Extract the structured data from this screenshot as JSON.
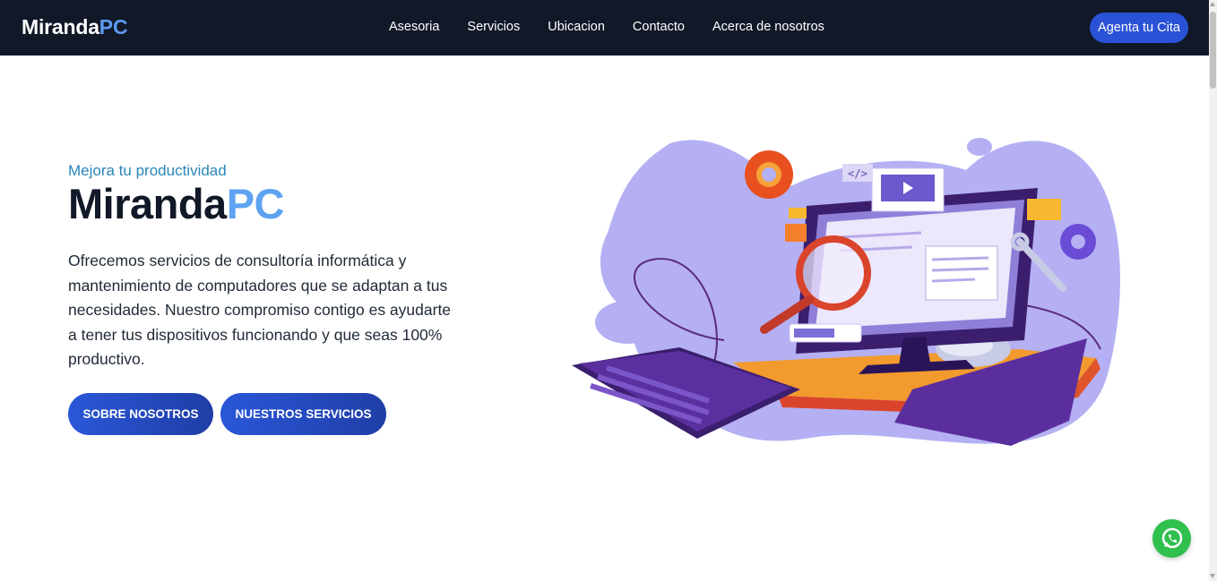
{
  "header": {
    "brand_main": "Miranda",
    "brand_accent": "PC",
    "nav": [
      "Asesoria",
      "Servicios",
      "Ubicacion",
      "Contacto",
      "Acerca de nosotros"
    ],
    "cta_label": "Agenta tu Cita"
  },
  "hero": {
    "eyebrow": "Mejora tu productividad",
    "title_main": "Miranda",
    "title_accent": "PC",
    "description": "Ofrecemos servicios de consultoría informática y mantenimiento de computadores que se adaptan a tus necesidades. Nuestro compromiso contigo es ayudarte a tener tus dispositivos funcionando y que seas 100% productivo.",
    "button_about": "SOBRE NOSOTROS",
    "button_services": "NUESTROS SERVICIOS"
  },
  "colors": {
    "navbar_bg": "#111827",
    "accent_blue": "#5b9cf0",
    "button_blue": "#2a52d6",
    "eyebrow": "#2a86b8",
    "whatsapp_green": "#2fc04d"
  },
  "icons": {
    "floating": "whatsapp-icon",
    "illustration": "computer-maintenance-illustration"
  }
}
